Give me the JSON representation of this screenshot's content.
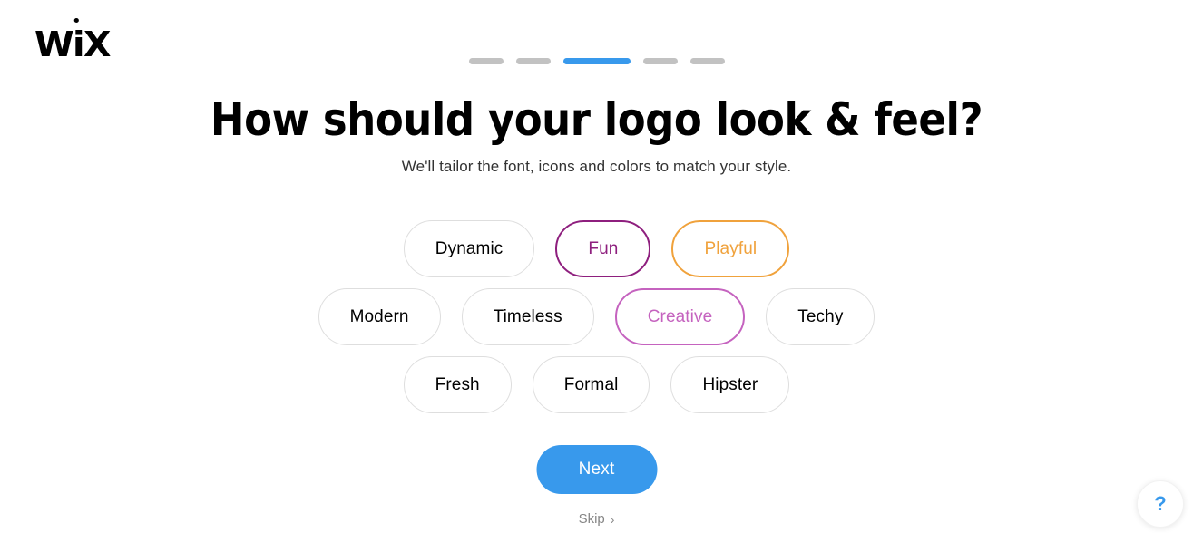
{
  "brand": {
    "logo_text": "WiX",
    "logo_part_1": "W",
    "logo_part_2": "i",
    "logo_part_3": "X",
    "accent_blue": "#3899ec"
  },
  "progress": {
    "total_steps": 5,
    "active_step": 3,
    "inactive_color": "#c2c2c2",
    "active_color": "#3899ec"
  },
  "header": {
    "title": "How should your logo look & feel?",
    "subtitle": "We'll tailor the font, icons and colors to match your style."
  },
  "chips": {
    "rows": [
      [
        {
          "label": "Dynamic",
          "selected": false,
          "color": "#000000"
        },
        {
          "label": "Fun",
          "selected": true,
          "color": "#8e1f7e"
        },
        {
          "label": "Playful",
          "selected": true,
          "color": "#f0a23c"
        }
      ],
      [
        {
          "label": "Modern",
          "selected": false,
          "color": "#000000"
        },
        {
          "label": "Timeless",
          "selected": false,
          "color": "#000000"
        },
        {
          "label": "Creative",
          "selected": true,
          "color": "#c563bf"
        },
        {
          "label": "Techy",
          "selected": false,
          "color": "#000000"
        }
      ],
      [
        {
          "label": "Fresh",
          "selected": false,
          "color": "#000000"
        },
        {
          "label": "Formal",
          "selected": false,
          "color": "#000000"
        },
        {
          "label": "Hipster",
          "selected": false,
          "color": "#000000"
        }
      ]
    ]
  },
  "actions": {
    "next_label": "Next",
    "skip_label": "Skip",
    "skip_chevron": "›"
  },
  "help": {
    "glyph": "?",
    "icon_name": "question-mark-icon"
  }
}
